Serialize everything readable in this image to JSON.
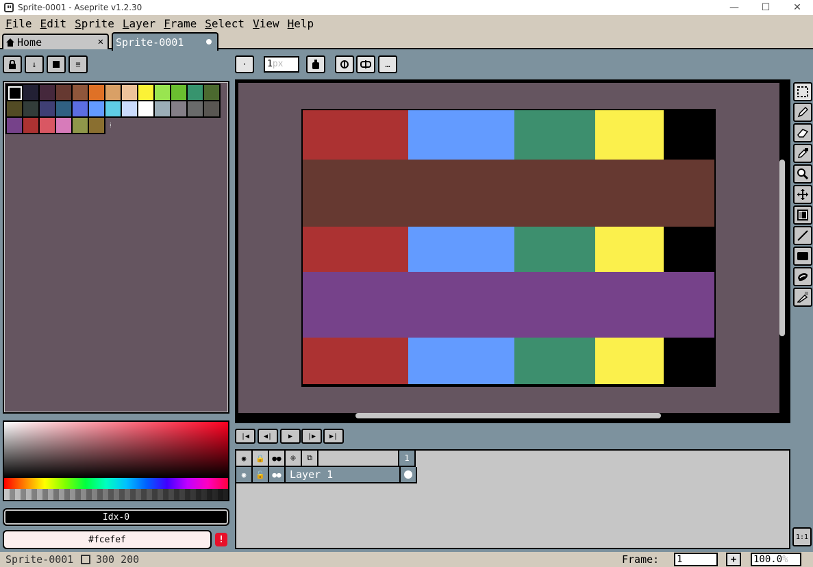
{
  "window": {
    "title": "Sprite-0001 - Aseprite v1.2.30",
    "minimize_glyph": "—",
    "maximize_glyph": "☐",
    "close_glyph": "✕"
  },
  "menu": [
    "File",
    "Edit",
    "Sprite",
    "Layer",
    "Frame",
    "Select",
    "View",
    "Help"
  ],
  "tabs": {
    "home_label": "Home",
    "home_close": "✕",
    "sprite_label": "Sprite-0001"
  },
  "palette_toolbar": {
    "lock_icon": "lock-icon",
    "sort_icon": "sort-down-icon",
    "presets_icon": "presets-icon",
    "options_icon": "options-icon",
    "sort_glyph": "↓",
    "options_glyph": "≡"
  },
  "context_bar": {
    "brush_glyph": "·",
    "brush_size_value": "1",
    "brush_size_placeholder": "px",
    "more_glyph": "…"
  },
  "palette": {
    "colors": [
      "#000000",
      "#222034",
      "#45283c",
      "#663931",
      "#8f563b",
      "#df7126",
      "#d9a066",
      "#eec39a",
      "#fbf236",
      "#99e550",
      "#6abe30",
      "#37946e",
      "#4b692f",
      "#524b24",
      "#323c39",
      "#3f3f74",
      "#306082",
      "#5b6ee1",
      "#639bff",
      "#5fcde4",
      "#cbdbfc",
      "#ffffff",
      "#9badb7",
      "#847e87",
      "#696a6a",
      "#595652",
      "#76428a",
      "#ac3232",
      "#d95763",
      "#d77bba",
      "#8f974a",
      "#8a6f30"
    ],
    "grip_glyph": "⁞"
  },
  "color_bar": {
    "index_label": "Idx-0",
    "hex_label": "#fcefef",
    "warning_glyph": "!"
  },
  "sprite_canvas": {
    "stripes": [
      {
        "type": "row",
        "height_frac": 0.18,
        "cells": [
          {
            "color": "#ac3232",
            "w": 0.256
          },
          {
            "color": "#639bff",
            "w": 0.258
          },
          {
            "color": "#3d8f6e",
            "w": 0.196
          },
          {
            "color": "#fbf04c",
            "w": 0.166
          },
          {
            "color": "#000000",
            "w": 0.124
          }
        ]
      },
      {
        "type": "band",
        "height_frac": 0.245,
        "color": "#663931"
      },
      {
        "type": "row",
        "height_frac": 0.165,
        "cells": [
          {
            "color": "#ac3232",
            "w": 0.256
          },
          {
            "color": "#639bff",
            "w": 0.258
          },
          {
            "color": "#3d8f6e",
            "w": 0.196
          },
          {
            "color": "#fbf04c",
            "w": 0.166
          },
          {
            "color": "#000000",
            "w": 0.124
          }
        ]
      },
      {
        "type": "band",
        "height_frac": 0.24,
        "color": "#76428a"
      },
      {
        "type": "row",
        "height_frac": 0.17,
        "cells": [
          {
            "color": "#ac3232",
            "w": 0.256
          },
          {
            "color": "#639bff",
            "w": 0.258
          },
          {
            "color": "#3d8f6e",
            "w": 0.196
          },
          {
            "color": "#fbf04c",
            "w": 0.166
          },
          {
            "color": "#000000",
            "w": 0.124
          }
        ]
      }
    ]
  },
  "tools": [
    "selection-icon",
    "pencil-icon",
    "eraser-icon",
    "eyedropper-icon",
    "zoom-icon",
    "move-icon",
    "paint-bucket-icon",
    "line-icon",
    "rectangle-icon",
    "contour-icon",
    "blur-icon"
  ],
  "playback": {
    "first_glyph": "|◀",
    "prev_glyph": "◀|",
    "play_glyph": "▶",
    "next_glyph": "|▶",
    "last_glyph": "▶|"
  },
  "timeline": {
    "frame_number": "1",
    "layer_name": "Layer 1",
    "eye_glyph": "◉",
    "lock_glyph": "🔓",
    "cont_glyph": "●●",
    "header_eye_glyph": "◉",
    "header_lock_glyph": "🔒",
    "header_cont_glyph": "●●",
    "header_link_glyph": "⁜",
    "header_onion_glyph": "⧉"
  },
  "status": {
    "sprite_name": "Sprite-0001",
    "size": "300 200",
    "frame_label": "Frame:",
    "frame_value": "1",
    "add_glyph": "+",
    "zoom_value": "100.0",
    "zoom_unit": "%",
    "ratio_label": "1:1"
  }
}
